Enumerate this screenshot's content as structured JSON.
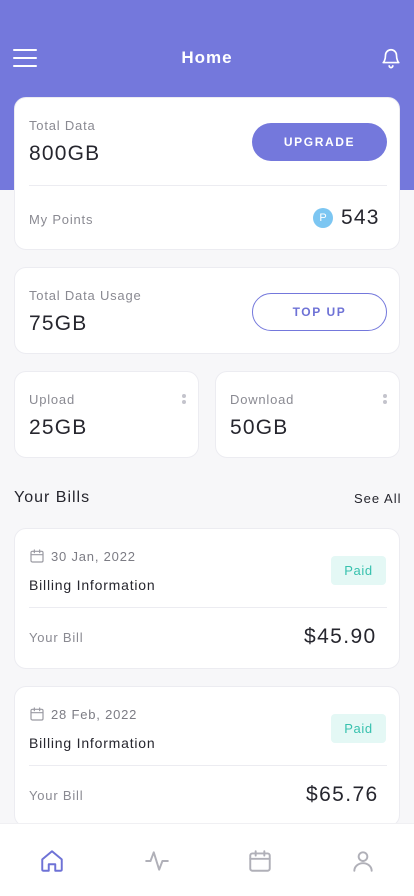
{
  "header": {
    "title": "Home"
  },
  "data_card": {
    "total_label": "Total Data",
    "total_value": "800GB",
    "upgrade_label": "UPGRADE",
    "points_label": "My Points",
    "points_badge": "P",
    "points_value": "543"
  },
  "usage_card": {
    "label": "Total Data Usage",
    "value": "75GB",
    "topup_label": "TOP UP"
  },
  "upload_card": {
    "label": "Upload",
    "value": "25GB"
  },
  "download_card": {
    "label": "Download",
    "value": "50GB"
  },
  "bills_section": {
    "title": "Your Bills",
    "see_all": "See All"
  },
  "bills": [
    {
      "date": "30 Jan, 2022",
      "title": "Billing Information",
      "status": "Paid",
      "bill_label": "Your Bill",
      "amount": "$45.90"
    },
    {
      "date": "28 Feb, 2022",
      "title": "Billing Information",
      "status": "Paid",
      "bill_label": "Your Bill",
      "amount": "$65.76"
    }
  ],
  "bottom_nav": {
    "items": [
      {
        "icon": "home-icon",
        "active": true
      },
      {
        "icon": "activity-icon",
        "active": false
      },
      {
        "icon": "calendar-icon",
        "active": false
      },
      {
        "icon": "profile-icon",
        "active": false
      }
    ]
  },
  "colors": {
    "accent": "#7478dc",
    "paid_text": "#37c1ae",
    "paid_bg": "#e4f8f5",
    "points_badge": "#7cc6f2"
  }
}
